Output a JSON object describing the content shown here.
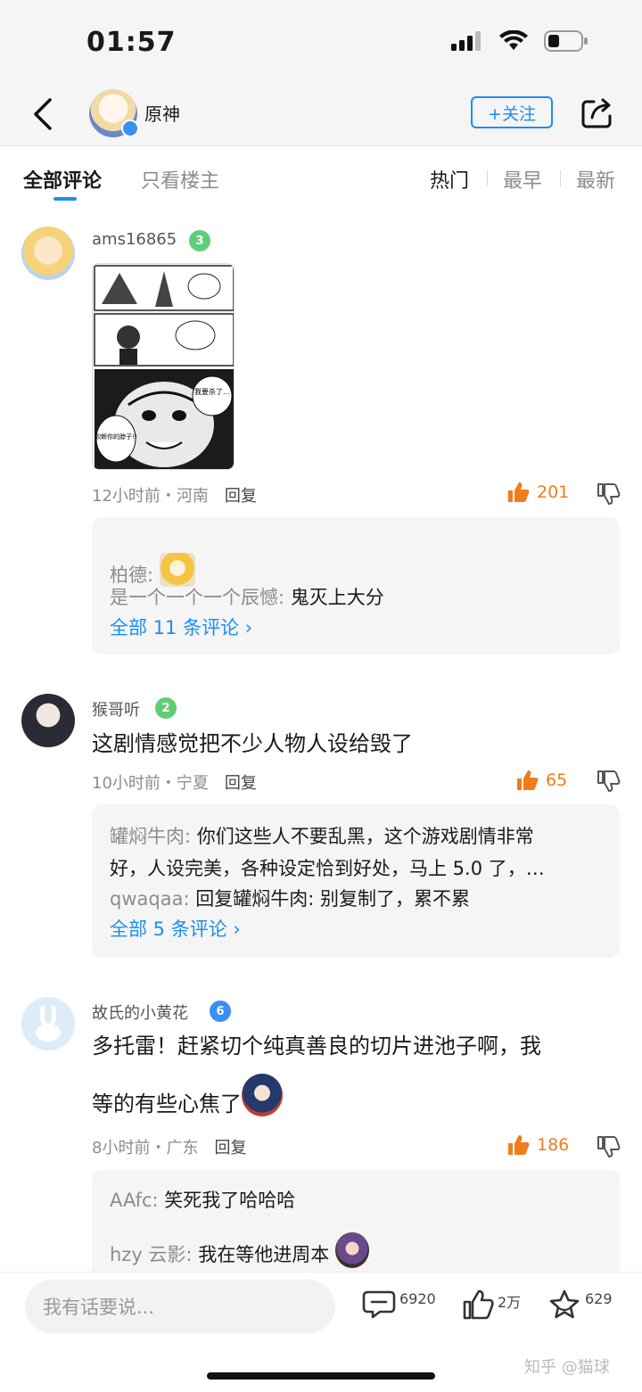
{
  "status_bar": {
    "time": "01:57"
  },
  "nav": {
    "title": "原神",
    "follow_label": "+关注"
  },
  "tabs": {
    "all_comments": "全部评论",
    "op_only": "只看楼主"
  },
  "sort": {
    "hot": "热门",
    "earliest": "最早",
    "latest": "最新"
  },
  "comments": [
    {
      "username": "ams16865",
      "level": "3",
      "level_color": "#5fcf77",
      "text": "",
      "manga_texts": [
        "我要杀了…",
        "砍断你的脖子!!"
      ],
      "time_location": "12小时前・河南",
      "reply_label": "回复",
      "likes": "201",
      "replies": [
        {
          "name": "柏德:",
          "text": ""
        },
        {
          "name": "是一个一个一个辰憾:",
          "text": "鬼灭上大分"
        }
      ],
      "more_label": "全部 11 条评论 ›"
    },
    {
      "username": "猴哥听",
      "level": "2",
      "level_color": "#5fcf77",
      "text": "这剧情感觉把不少人物人设给毁了",
      "time_location": "10小时前・宁夏",
      "reply_label": "回复",
      "likes": "65",
      "replies": [
        {
          "name": "罐焖牛肉:",
          "text": "你们这些人不要乱黑，这个游戏剧情非常"
        },
        {
          "name": "",
          "text": "好，人设完美，各种设定恰到好处，马上 5.0 了，…"
        },
        {
          "name": "qwaqaa:",
          "text": "回复罐焖牛肉: 别复制了，累不累"
        }
      ],
      "more_label": "全部 5 条评论 ›"
    },
    {
      "username": "故氏的小黄花",
      "level": "6",
      "level_color": "#3a8ef6",
      "text_line1": "多托雷！赶紧切个纯真善良的切片进池子啊，我",
      "text_line2": "等的有些心焦了",
      "time_location": "8小时前・广东",
      "reply_label": "回复",
      "likes": "186",
      "replies": [
        {
          "name": "AAfc:",
          "text": "笑死我了哈哈哈"
        },
        {
          "name": "hzy 云影:",
          "text": "我在等他进周本"
        }
      ]
    }
  ],
  "bottom": {
    "input_placeholder": "我有话要说...",
    "comment_count": "6920",
    "like_count": "2万",
    "fav_count": "629",
    "watermark": "知乎 @猫球"
  },
  "colors": {
    "accent": "#1a8ff0",
    "like": "#f07d1a"
  }
}
